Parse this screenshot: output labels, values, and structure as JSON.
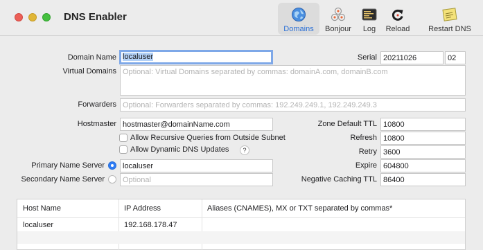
{
  "window": {
    "title": "DNS Enabler"
  },
  "toolbar": {
    "domains": "Domains",
    "bonjour": "Bonjour",
    "log": "Log",
    "reload": "Reload",
    "restart": "Restart DNS"
  },
  "form": {
    "domain_name_label": "Domain Name",
    "domain_name_value": "localuser",
    "virtual_domains_label": "Virtual Domains",
    "virtual_domains_placeholder": "Optional: Virtual Domains separated by commas: domainA.com, domainB.com",
    "forwarders_label": "Forwarders",
    "forwarders_placeholder": "Optional: Forwarders separated by commas: 192.249.249.1, 192.249.249.3",
    "hostmaster_label": "Hostmaster",
    "hostmaster_value": "hostmaster@domainName.com",
    "allow_recursive_label": "Allow Recursive Queries from Outside Subnet",
    "allow_recursive_checked": false,
    "allow_dynamic_label": "Allow Dynamic DNS Updates",
    "allow_dynamic_checked": false,
    "help_glyph": "?",
    "primary_ns_label": "Primary Name Server",
    "primary_ns_value": "localuser",
    "primary_ns_selected": true,
    "secondary_ns_label": "Secondary Name Server",
    "secondary_ns_placeholder": "Optional",
    "secondary_ns_selected": false,
    "serial_label": "Serial",
    "serial_value": "20211026",
    "serial_suffix": "02",
    "zone_ttl_label": "Zone Default TTL",
    "zone_ttl_value": "10800",
    "refresh_label": "Refresh",
    "refresh_value": "10800",
    "retry_label": "Retry",
    "retry_value": "3600",
    "expire_label": "Expire",
    "expire_value": "604800",
    "neg_cache_label": "Negative Caching TTL",
    "neg_cache_value": "86400"
  },
  "table": {
    "columns": [
      "Host Name",
      "IP Address",
      "Aliases (CNAMES), MX or TXT separated by commas*"
    ],
    "rows": [
      {
        "host": "localuser",
        "ip": "192.168.178.47",
        "aliases": ""
      }
    ]
  },
  "colors": {
    "accent": "#2e7cf6",
    "close": "#ec5f57",
    "minimize": "#e0b637",
    "maximize": "#45c03f"
  }
}
